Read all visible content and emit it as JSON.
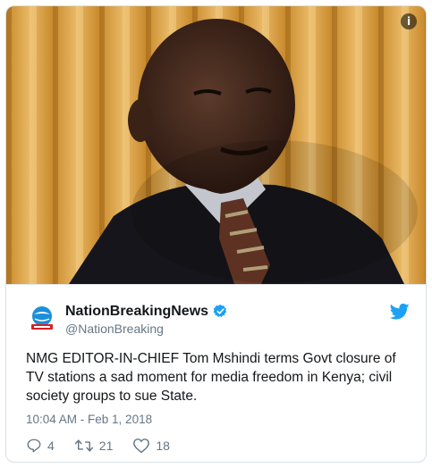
{
  "media": {
    "alt_icon": "info-icon",
    "info_label": "i",
    "subject": "photo of a man in a dark suit and patterned tie in front of a yellow curtain"
  },
  "author": {
    "display_name": "NationBreakingNews",
    "handle": "@NationBreaking",
    "verified": true,
    "avatar_icon": "globe-logo-icon"
  },
  "tweet": {
    "text": "NMG EDITOR-IN-CHIEF Tom Mshindi terms Govt closure of TV stations a sad moment for media freedom in Kenya; civil society groups to sue State.",
    "timestamp": "10:04 AM - Feb 1, 2018"
  },
  "actions": {
    "replies": "4",
    "retweets": "21",
    "likes": "18"
  },
  "colors": {
    "twitter_blue": "#1da1f2",
    "muted_text": "#657786",
    "border": "#e1e8ed"
  }
}
